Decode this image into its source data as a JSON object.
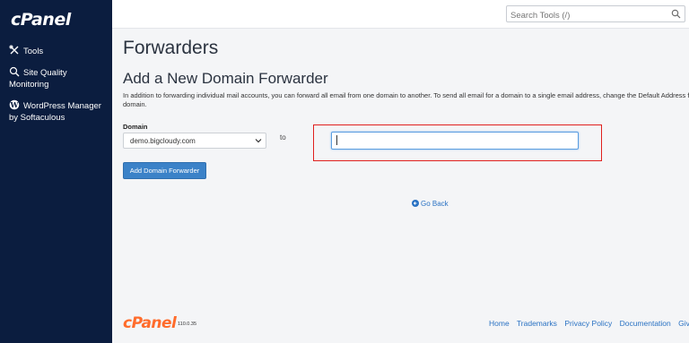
{
  "brand": {
    "logo_text": "cPanel",
    "version": "110.0.35"
  },
  "sidebar": {
    "items": [
      {
        "label": "Tools"
      },
      {
        "label": "Site Quality Monitoring"
      },
      {
        "label": "WordPress Manager by Softaculous"
      }
    ]
  },
  "search": {
    "placeholder": "Search Tools (/)"
  },
  "main": {
    "page_title": "Forwarders",
    "section_title": "Add a New Domain Forwarder",
    "description": "In addition to forwarding individual mail accounts, you can forward all email from one domain to another. To send all email for a domain to a single email address, change the Default Address for that domain.",
    "domain_label": "Domain",
    "domain_selected": "demo.bigcloudy.com",
    "to_label": "to",
    "destination_value": "",
    "add_button_label": "Add Domain Forwarder",
    "go_back_label": "Go Back"
  },
  "footer": {
    "links": [
      "Home",
      "Trademarks",
      "Privacy Policy",
      "Documentation",
      "Give Feedback"
    ]
  },
  "colors": {
    "sidebar_bg": "#0b1d3f",
    "accent": "#3b82c8",
    "brand_orange": "#ff6c2c",
    "highlight_red": "#e0201e"
  }
}
